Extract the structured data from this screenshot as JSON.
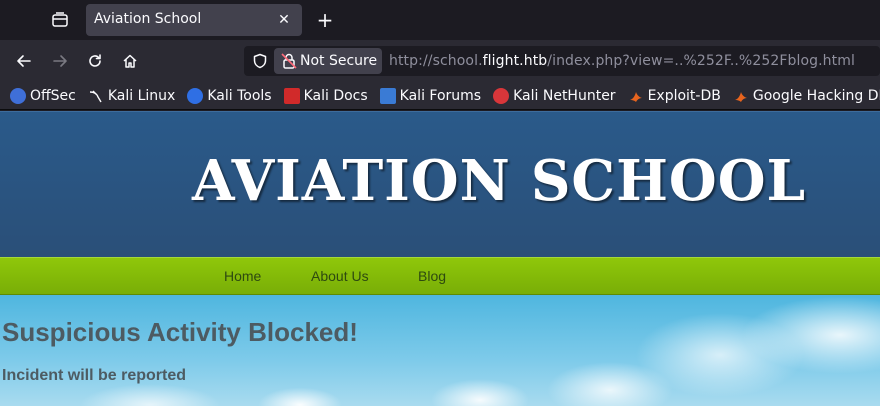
{
  "browser": {
    "tab": {
      "title": "Aviation School"
    },
    "url_bar": {
      "security_label": "Not Secure",
      "url_prefix": "http://school.",
      "url_domain": "flight.htb",
      "url_suffix": "/index.php?view=..%252F..%252Fblog.html"
    },
    "bookmarks": [
      {
        "label": "OffSec",
        "icon": "offsec-icon",
        "color": "#3f6fd8"
      },
      {
        "label": "Kali Linux",
        "icon": "kali-dragon-icon",
        "color": "#2b2a33"
      },
      {
        "label": "Kali Tools",
        "icon": "kali-tools-icon",
        "color": "#2f6fe4"
      },
      {
        "label": "Kali Docs",
        "icon": "kali-docs-icon",
        "color": "#d12a2a"
      },
      {
        "label": "Kali Forums",
        "icon": "kali-forums-icon",
        "color": "#3a7bd5"
      },
      {
        "label": "Kali NetHunter",
        "icon": "kali-nethunter-icon",
        "color": "#d8363a"
      },
      {
        "label": "Exploit-DB",
        "icon": "exploit-db-icon",
        "color": "#e8641e"
      },
      {
        "label": "Google Hacking DB",
        "icon": "ghdb-icon",
        "color": "#e8641e"
      }
    ]
  },
  "site": {
    "title": "AVIATION SCHOOL",
    "menu": [
      "Home",
      "About Us",
      "Blog"
    ],
    "message": {
      "title": "Suspicious Activity Blocked!",
      "subtitle": "Incident will be reported"
    }
  }
}
